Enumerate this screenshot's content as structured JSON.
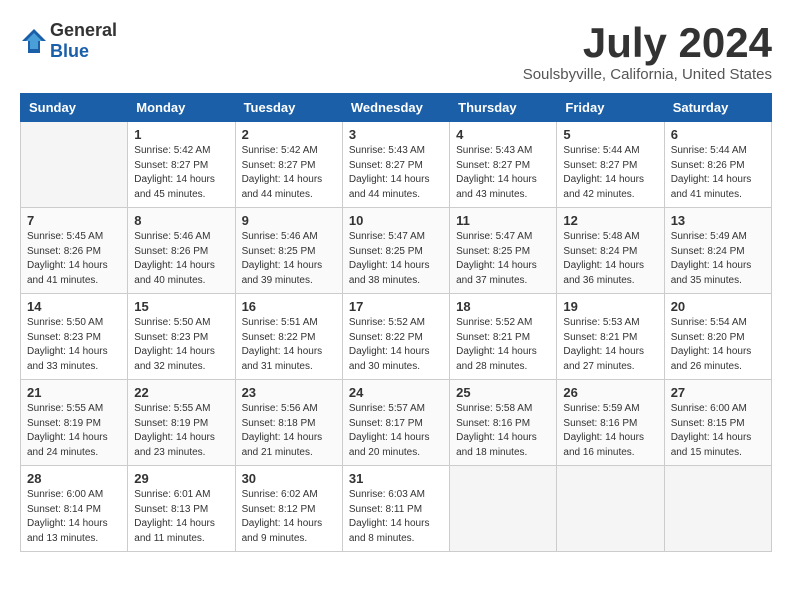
{
  "logo": {
    "general": "General",
    "blue": "Blue"
  },
  "title": "July 2024",
  "subtitle": "Soulsbyville, California, United States",
  "headers": [
    "Sunday",
    "Monday",
    "Tuesday",
    "Wednesday",
    "Thursday",
    "Friday",
    "Saturday"
  ],
  "weeks": [
    [
      {
        "day": "",
        "sunrise": "",
        "sunset": "",
        "daylight": "",
        "empty": true
      },
      {
        "day": "1",
        "sunrise": "Sunrise: 5:42 AM",
        "sunset": "Sunset: 8:27 PM",
        "daylight": "Daylight: 14 hours and 45 minutes."
      },
      {
        "day": "2",
        "sunrise": "Sunrise: 5:42 AM",
        "sunset": "Sunset: 8:27 PM",
        "daylight": "Daylight: 14 hours and 44 minutes."
      },
      {
        "day": "3",
        "sunrise": "Sunrise: 5:43 AM",
        "sunset": "Sunset: 8:27 PM",
        "daylight": "Daylight: 14 hours and 44 minutes."
      },
      {
        "day": "4",
        "sunrise": "Sunrise: 5:43 AM",
        "sunset": "Sunset: 8:27 PM",
        "daylight": "Daylight: 14 hours and 43 minutes."
      },
      {
        "day": "5",
        "sunrise": "Sunrise: 5:44 AM",
        "sunset": "Sunset: 8:27 PM",
        "daylight": "Daylight: 14 hours and 42 minutes."
      },
      {
        "day": "6",
        "sunrise": "Sunrise: 5:44 AM",
        "sunset": "Sunset: 8:26 PM",
        "daylight": "Daylight: 14 hours and 41 minutes."
      }
    ],
    [
      {
        "day": "7",
        "sunrise": "Sunrise: 5:45 AM",
        "sunset": "Sunset: 8:26 PM",
        "daylight": "Daylight: 14 hours and 41 minutes."
      },
      {
        "day": "8",
        "sunrise": "Sunrise: 5:46 AM",
        "sunset": "Sunset: 8:26 PM",
        "daylight": "Daylight: 14 hours and 40 minutes."
      },
      {
        "day": "9",
        "sunrise": "Sunrise: 5:46 AM",
        "sunset": "Sunset: 8:25 PM",
        "daylight": "Daylight: 14 hours and 39 minutes."
      },
      {
        "day": "10",
        "sunrise": "Sunrise: 5:47 AM",
        "sunset": "Sunset: 8:25 PM",
        "daylight": "Daylight: 14 hours and 38 minutes."
      },
      {
        "day": "11",
        "sunrise": "Sunrise: 5:47 AM",
        "sunset": "Sunset: 8:25 PM",
        "daylight": "Daylight: 14 hours and 37 minutes."
      },
      {
        "day": "12",
        "sunrise": "Sunrise: 5:48 AM",
        "sunset": "Sunset: 8:24 PM",
        "daylight": "Daylight: 14 hours and 36 minutes."
      },
      {
        "day": "13",
        "sunrise": "Sunrise: 5:49 AM",
        "sunset": "Sunset: 8:24 PM",
        "daylight": "Daylight: 14 hours and 35 minutes."
      }
    ],
    [
      {
        "day": "14",
        "sunrise": "Sunrise: 5:50 AM",
        "sunset": "Sunset: 8:23 PM",
        "daylight": "Daylight: 14 hours and 33 minutes."
      },
      {
        "day": "15",
        "sunrise": "Sunrise: 5:50 AM",
        "sunset": "Sunset: 8:23 PM",
        "daylight": "Daylight: 14 hours and 32 minutes."
      },
      {
        "day": "16",
        "sunrise": "Sunrise: 5:51 AM",
        "sunset": "Sunset: 8:22 PM",
        "daylight": "Daylight: 14 hours and 31 minutes."
      },
      {
        "day": "17",
        "sunrise": "Sunrise: 5:52 AM",
        "sunset": "Sunset: 8:22 PM",
        "daylight": "Daylight: 14 hours and 30 minutes."
      },
      {
        "day": "18",
        "sunrise": "Sunrise: 5:52 AM",
        "sunset": "Sunset: 8:21 PM",
        "daylight": "Daylight: 14 hours and 28 minutes."
      },
      {
        "day": "19",
        "sunrise": "Sunrise: 5:53 AM",
        "sunset": "Sunset: 8:21 PM",
        "daylight": "Daylight: 14 hours and 27 minutes."
      },
      {
        "day": "20",
        "sunrise": "Sunrise: 5:54 AM",
        "sunset": "Sunset: 8:20 PM",
        "daylight": "Daylight: 14 hours and 26 minutes."
      }
    ],
    [
      {
        "day": "21",
        "sunrise": "Sunrise: 5:55 AM",
        "sunset": "Sunset: 8:19 PM",
        "daylight": "Daylight: 14 hours and 24 minutes."
      },
      {
        "day": "22",
        "sunrise": "Sunrise: 5:55 AM",
        "sunset": "Sunset: 8:19 PM",
        "daylight": "Daylight: 14 hours and 23 minutes."
      },
      {
        "day": "23",
        "sunrise": "Sunrise: 5:56 AM",
        "sunset": "Sunset: 8:18 PM",
        "daylight": "Daylight: 14 hours and 21 minutes."
      },
      {
        "day": "24",
        "sunrise": "Sunrise: 5:57 AM",
        "sunset": "Sunset: 8:17 PM",
        "daylight": "Daylight: 14 hours and 20 minutes."
      },
      {
        "day": "25",
        "sunrise": "Sunrise: 5:58 AM",
        "sunset": "Sunset: 8:16 PM",
        "daylight": "Daylight: 14 hours and 18 minutes."
      },
      {
        "day": "26",
        "sunrise": "Sunrise: 5:59 AM",
        "sunset": "Sunset: 8:16 PM",
        "daylight": "Daylight: 14 hours and 16 minutes."
      },
      {
        "day": "27",
        "sunrise": "Sunrise: 6:00 AM",
        "sunset": "Sunset: 8:15 PM",
        "daylight": "Daylight: 14 hours and 15 minutes."
      }
    ],
    [
      {
        "day": "28",
        "sunrise": "Sunrise: 6:00 AM",
        "sunset": "Sunset: 8:14 PM",
        "daylight": "Daylight: 14 hours and 13 minutes."
      },
      {
        "day": "29",
        "sunrise": "Sunrise: 6:01 AM",
        "sunset": "Sunset: 8:13 PM",
        "daylight": "Daylight: 14 hours and 11 minutes."
      },
      {
        "day": "30",
        "sunrise": "Sunrise: 6:02 AM",
        "sunset": "Sunset: 8:12 PM",
        "daylight": "Daylight: 14 hours and 9 minutes."
      },
      {
        "day": "31",
        "sunrise": "Sunrise: 6:03 AM",
        "sunset": "Sunset: 8:11 PM",
        "daylight": "Daylight: 14 hours and 8 minutes."
      },
      {
        "day": "",
        "sunrise": "",
        "sunset": "",
        "daylight": "",
        "empty": true
      },
      {
        "day": "",
        "sunrise": "",
        "sunset": "",
        "daylight": "",
        "empty": true
      },
      {
        "day": "",
        "sunrise": "",
        "sunset": "",
        "daylight": "",
        "empty": true
      }
    ]
  ]
}
